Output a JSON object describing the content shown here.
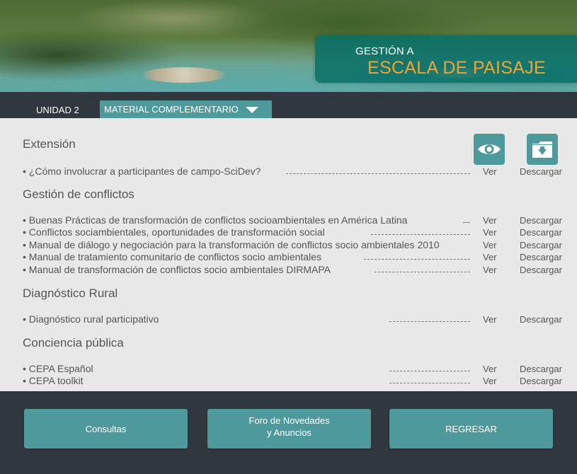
{
  "header": {
    "title_line1": "GESTIÓN A",
    "title_line2": "ESCALA DE PAISAJE"
  },
  "nav": {
    "unit": "UNIDAD 2",
    "dropdown_label": "MATERIAL COMPLEMENTARIO"
  },
  "content": {
    "icons": {
      "view": "eye-icon",
      "download": "folder-download-icon"
    },
    "sections": [
      {
        "title": "Extensión",
        "items": [
          {
            "text": "• ¿Cómo involucrar a participantes de campo-SciDev?",
            "view": "Ver",
            "download": "Descargar"
          }
        ]
      },
      {
        "title": "Gestión de conflictos",
        "items": [
          {
            "text": "• Buenas Prácticas de transformación de conflictos socioambientales en América Latina",
            "view": "Ver",
            "download": "Descargar"
          },
          {
            "text": "• Conflictos sociambientales, oportunidades de transformación social",
            "view": "Ver",
            "download": "Descargar"
          },
          {
            "text": "• Manual de diálogo y negociación para la transformación de conflictos socio ambientales 2010",
            "view": "Ver",
            "download": "Descargar"
          },
          {
            "text": "• Manual de tratamiento comunitario de conflictos socio ambientales",
            "view": "Ver",
            "download": "Descargar"
          },
          {
            "text": "• Manual de transformación de conflictos socio ambientales DIRMAPA",
            "view": "Ver",
            "download": "Descargar"
          }
        ]
      },
      {
        "title": "Diagnóstico Rural",
        "items": [
          {
            "text": "• Diagnóstico rural participativo",
            "view": "Ver",
            "download": "Descargar"
          }
        ]
      },
      {
        "title": "Conciencia pública",
        "items": [
          {
            "text": "• CEPA Español",
            "view": "Ver",
            "download": "Descargar"
          },
          {
            "text": "• CEPA toolkit",
            "view": "Ver",
            "download": "Descargar"
          }
        ]
      }
    ]
  },
  "footer": {
    "consultas": "Consultas",
    "foro_line1": "Foro de Novedades",
    "foro_line2": "y Anuncios",
    "regresar": "REGRESAR"
  },
  "colors": {
    "teal": "#4e999c",
    "dark": "#31373f",
    "accent": "#f2a431",
    "title_box": "#087068"
  }
}
